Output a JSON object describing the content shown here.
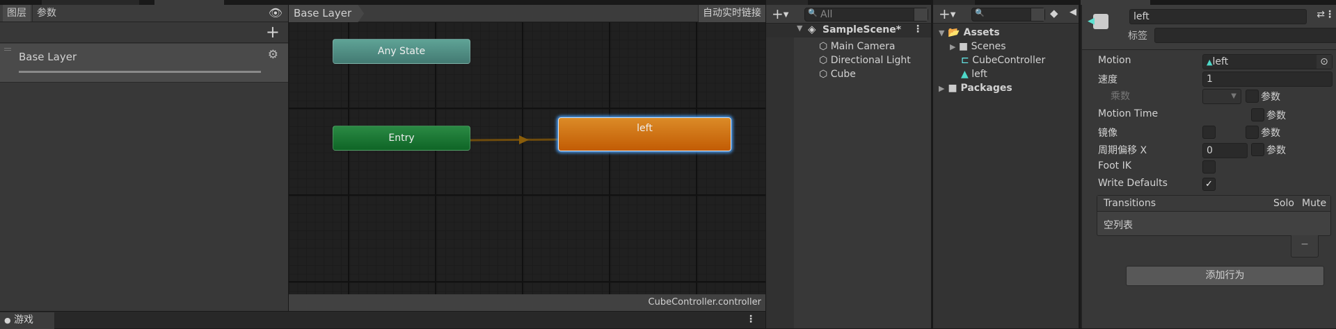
{
  "layers_panel": {
    "tabs": [
      {
        "label": "图层",
        "active": true
      },
      {
        "label": "参数",
        "active": false
      }
    ],
    "eye_icon": "eye-icon",
    "add_icon": "plus-icon",
    "layer": {
      "name": "Base Layer",
      "settings_icon": "gear-icon"
    }
  },
  "graph": {
    "breadcrumb": "Base Layer",
    "auto_live_link_label": "自动实时链接",
    "nodes": {
      "any_state": "Any State",
      "entry": "Entry",
      "default_state": "left"
    },
    "status_file": "CubeController.controller",
    "colors": {
      "any_state": "#4e8f86",
      "entry": "#1a6e2e",
      "default_state": "#d07a16",
      "selection": "#4aa3ff"
    }
  },
  "hierarchy": {
    "search_placeholder": "All",
    "scene": "SampleScene*",
    "objects": [
      "Main Camera",
      "Directional Light",
      "Cube"
    ]
  },
  "project": {
    "root": "Assets",
    "items": [
      {
        "name": "Scenes",
        "type": "folder"
      },
      {
        "name": "CubeController",
        "type": "animator-controller"
      },
      {
        "name": "left",
        "type": "animation-clip"
      }
    ],
    "packages": "Packages"
  },
  "inspector": {
    "name": "left",
    "tag_label": "标签",
    "tag_value": "",
    "motion_label": "Motion",
    "motion_value": "left",
    "speed_label": "速度",
    "speed_value": "1",
    "multiplier_label": "乘数",
    "param_label": "参数",
    "motion_time_label": "Motion Time",
    "mirror_label": "镜像",
    "cycle_offset_label": "周期偏移 X",
    "cycle_offset_value": "0",
    "foot_ik_label": "Foot IK",
    "foot_ik": false,
    "write_defaults_label": "Write Defaults",
    "write_defaults": true,
    "transitions": {
      "header": "Transitions",
      "solo": "Solo",
      "mute": "Mute",
      "empty": "空列表",
      "remove": "−"
    },
    "add_behaviour_label": "添加行为"
  },
  "bottom": {
    "game_tab": "游戏"
  }
}
